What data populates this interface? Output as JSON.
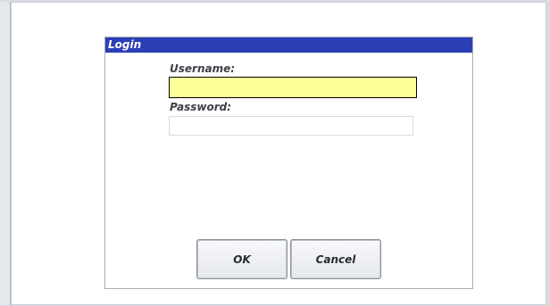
{
  "dialog": {
    "title": "Login",
    "fields": {
      "username": {
        "label": "Username:",
        "value": ""
      },
      "password": {
        "label": "Password:",
        "value": ""
      }
    },
    "buttons": {
      "ok": "OK",
      "cancel": "Cancel"
    }
  },
  "colors": {
    "titlebar": "#2b3fb5",
    "focused_input": "#ffff99"
  }
}
